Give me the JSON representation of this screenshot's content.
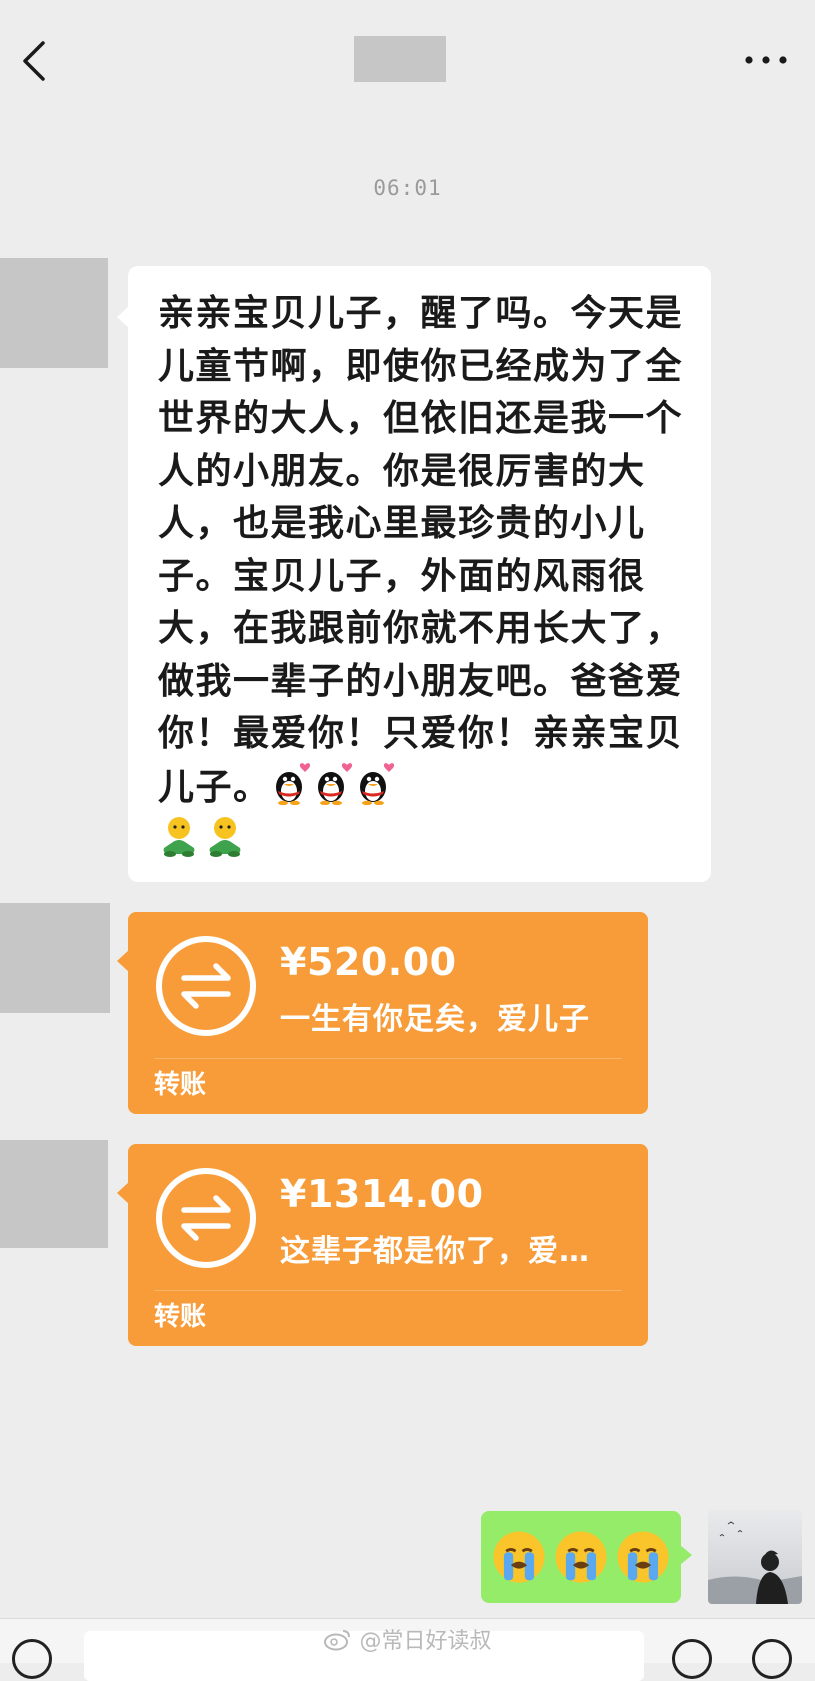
{
  "header": {
    "back_icon": "chevron-left-icon",
    "more_icon": "ellipsis-icon"
  },
  "chat": {
    "timestamp": "06:01",
    "message": {
      "text": "亲亲宝贝儿子，醒了吗。今天是儿童节啊，即使你已经成为了全世界的大人，但依旧还是我一个人的小朋友。你是很厉害的大人，也是我心里最珍贵的小儿子。宝贝儿子，外面的风雨很大，在我跟前你就不用长大了，做我一辈子的小朋友吧。爸爸爱你！最爱你！只爱你！亲亲宝贝儿子。",
      "emojis_inline": [
        "penguin-heart-emoji",
        "penguin-heart-emoji",
        "penguin-heart-emoji"
      ],
      "emojis_next": [
        "green-doll-emoji",
        "green-doll-emoji"
      ]
    },
    "transfers": [
      {
        "amount": "¥520.00",
        "note": "一生有你足矣，爱儿子",
        "label": "转账",
        "icon": "transfer-arrows-icon"
      },
      {
        "amount": "¥1314.00",
        "note": "这辈子都是你了，爱…",
        "label": "转账",
        "icon": "transfer-arrows-icon"
      }
    ],
    "reply": {
      "emojis": [
        "crying-face-emoji",
        "crying-face-emoji",
        "crying-face-emoji"
      ]
    }
  },
  "watermark": {
    "text": "@常日好读叔"
  },
  "colors": {
    "background": "#ededed",
    "transfer_orange": "#f79c38",
    "reply_green": "#95ec69",
    "placeholder_grey": "#c6c6c6"
  }
}
